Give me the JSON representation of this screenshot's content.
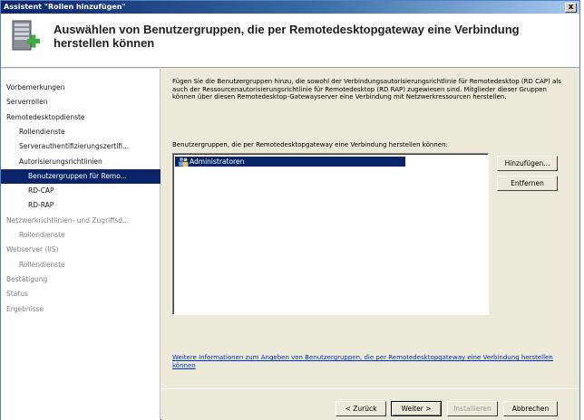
{
  "window": {
    "title": "Assistent \"Rollen hinzufügen\"",
    "close_label": "x",
    "header_title": "Auswählen von Benutzergruppen, die per Remotedesktopgateway eine Verbindung herstellen können",
    "header_icon": "server-role-add-icon"
  },
  "sidebar": {
    "items": [
      {
        "label": "Vorbemerkungen",
        "state": "normal",
        "indent": 1
      },
      {
        "label": "Serverrollen",
        "state": "normal",
        "indent": 1
      },
      {
        "label": "Remotedesktopdienste",
        "state": "normal",
        "indent": 1
      },
      {
        "label": "Rollendienste",
        "state": "normal",
        "indent": 2
      },
      {
        "label": "Serverauthentifizierungszertifi...",
        "state": "normal",
        "indent": 2
      },
      {
        "label": "Autorisierungsrichtlinien",
        "state": "normal",
        "indent": 2
      },
      {
        "label": "Benutzergruppen für Remo...",
        "state": "selected",
        "indent": 3
      },
      {
        "label": "RD-CAP",
        "state": "normal",
        "indent": 3
      },
      {
        "label": "RD-RAP",
        "state": "normal",
        "indent": 3
      },
      {
        "label": "Netzwerkrichtlinien- und Zugriffsd...",
        "state": "dim",
        "indent": 1
      },
      {
        "label": "Rollendienste",
        "state": "dim",
        "indent": 2
      },
      {
        "label": "Webserver (IIS)",
        "state": "dim",
        "indent": 1
      },
      {
        "label": "Rollendienste",
        "state": "dim",
        "indent": 2
      },
      {
        "label": "Bestätigung",
        "state": "dim",
        "indent": 1
      },
      {
        "label": "Status",
        "state": "dim",
        "indent": 1
      },
      {
        "label": "Ergebnisse",
        "state": "dim",
        "indent": 1
      }
    ]
  },
  "main": {
    "intro": "Fügen Sie die Benutzergruppen hinzu, die sowohl der Verbindungsautorisierungsrichtlinie für Remotedesktop (RD CAP) als auch der Ressourcenautorisierungsrichtlinie für Remotedesktop (RD RAP) zugewiesen sind. Mitglieder dieser Gruppen können über diesen Remotedesktop-Gatewayserver eine Verbindung mit Netzwerkressourcen herstellen.",
    "groups_label": "Benutzergruppen, die per Remotedesktopgateway eine Verbindung herstellen können:",
    "groups": [
      {
        "name": "Administratoren",
        "icon": "user-group-icon",
        "selected": true
      }
    ],
    "add_button": "Hinzufügen...",
    "remove_button": "Entfernen",
    "help_link": "Weitere Informationen zum Angeben von Benutzergruppen, die per Remotedesktopgateway eine Verbindung herstellen können"
  },
  "footer": {
    "back_button": "< Zurück",
    "next_button": "Weiter >",
    "install_button": "Installieren",
    "cancel_button": "Abbrechen"
  },
  "colors": {
    "selection": "#0a246a",
    "link": "#0033cc",
    "title_bar": "#0a246a"
  }
}
